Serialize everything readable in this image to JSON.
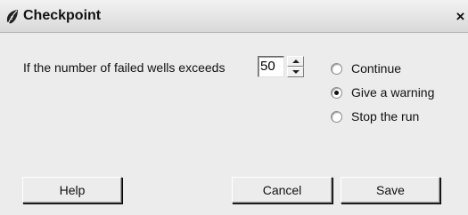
{
  "window": {
    "title": "Checkpoint",
    "close_label": "×"
  },
  "prompt": {
    "label": "If the number of failed wells exceeds",
    "value": "50"
  },
  "options": [
    {
      "label": "Continue",
      "checked": false
    },
    {
      "label": "Give a warning",
      "checked": true
    },
    {
      "label": "Stop the run",
      "checked": false
    }
  ],
  "buttons": {
    "help_label": "Help",
    "cancel_label": "Cancel",
    "save_label": "Save"
  }
}
